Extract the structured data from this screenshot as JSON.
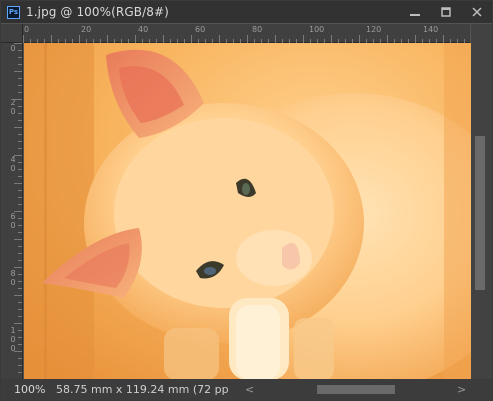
{
  "title": "1.jpg @ 100%(RGB/8#)",
  "app_icon": "photoshop-icon",
  "window_buttons": {
    "minimize": "▬",
    "maximize": "▢",
    "close": "✕"
  },
  "ruler_top_labels": [
    "0",
    "20",
    "40",
    "60",
    "80",
    "100",
    "120",
    "140"
  ],
  "ruler_left_labels": [
    [
      "0"
    ],
    [
      "2",
      "0"
    ],
    [
      "4",
      "0"
    ],
    [
      "6",
      "0"
    ],
    [
      "8",
      "0"
    ],
    [
      "1",
      "0",
      "0"
    ]
  ],
  "status": {
    "zoom": "100%",
    "doc_info": "58.75 mm x 119.24 mm (72 pp",
    "scroll_left_arrow": "<",
    "scroll_right_arrow": ">"
  },
  "colors": {
    "canvas_bg": "#535353",
    "titlebar": "#323232",
    "ruler": "#404040",
    "image_tone": "#f5a44a"
  }
}
